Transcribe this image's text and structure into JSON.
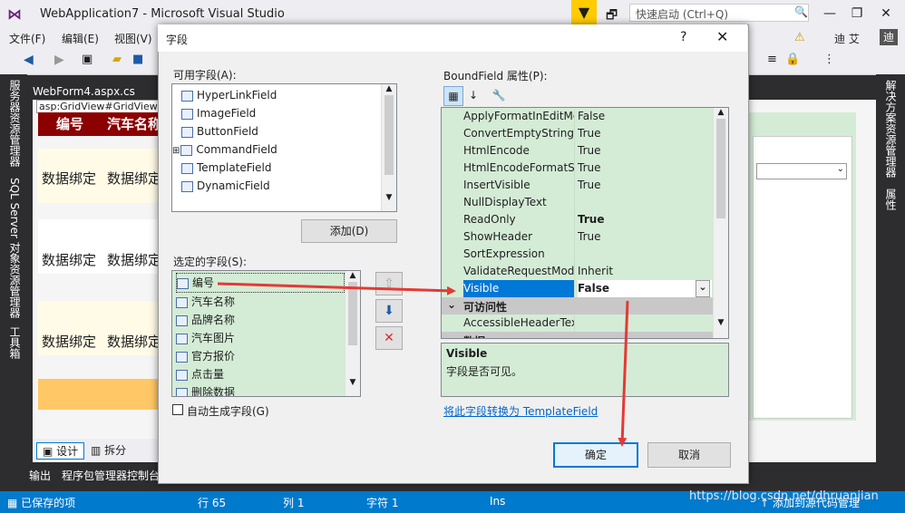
{
  "app": {
    "title": "WebApplication7 - Microsoft Visual Studio",
    "quick_launch_placeholder": "快速启动 (Ctrl+Q)",
    "user": "迪 艾",
    "user_badge": "迪"
  },
  "menu": [
    "文件(F)",
    "编辑(E)",
    "视图(V)"
  ],
  "left_tabs": [
    "服务器资源管理器",
    "SQL Server 对象资源管理器",
    "工具箱"
  ],
  "right_tabs": [
    "解决方案资源管理器",
    "属性"
  ],
  "document": {
    "tab": "WebForm4.aspx.cs",
    "asp_path": "asp:GridView#GridView1",
    "grid_header": [
      "编号",
      "汽车名称"
    ],
    "grid_rows": [
      [
        "数据绑定",
        "数据绑定"
      ],
      [
        "数据绑定",
        "数据绑定"
      ],
      [
        "数据绑定",
        "数据绑定"
      ]
    ],
    "bottom_tabs": [
      "设计",
      "拆分"
    ],
    "output_tabs": [
      "输出",
      "程序包管理器控制台"
    ]
  },
  "dialog": {
    "title": "字段",
    "help": "?",
    "available_label": "可用字段(A):",
    "available_fields": [
      "HyperLinkField",
      "ImageField",
      "ButtonField",
      "CommandField",
      "TemplateField",
      "DynamicField"
    ],
    "add_button": "添加(D)",
    "selected_label": "选定的字段(S):",
    "selected_fields": [
      "编号",
      "汽车名称",
      "品牌名称",
      "汽车图片",
      "官方报价",
      "点击量",
      "删除数据"
    ],
    "autogen_label": "自动生成字段(G)",
    "properties_label": "BoundField 属性(P):",
    "properties": [
      {
        "name": "ApplyFormatInEditMode",
        "value": "False"
      },
      {
        "name": "ConvertEmptyStringToNull",
        "value": "True"
      },
      {
        "name": "HtmlEncode",
        "value": "True"
      },
      {
        "name": "HtmlEncodeFormatString",
        "value": "True"
      },
      {
        "name": "InsertVisible",
        "value": "True"
      },
      {
        "name": "NullDisplayText",
        "value": ""
      },
      {
        "name": "ReadOnly",
        "value": "True"
      },
      {
        "name": "ShowHeader",
        "value": "True"
      },
      {
        "name": "SortExpression",
        "value": ""
      },
      {
        "name": "ValidateRequestMode",
        "value": "Inherit"
      },
      {
        "name": "Visible",
        "value": "False"
      }
    ],
    "category_accessibility": "可访问性",
    "accessible_header": "AccessibleHeaderText",
    "category_data": "数据",
    "desc_title": "Visible",
    "desc_text": "字段是否可见。",
    "convert_link": "将此字段转换为 TemplateField",
    "ok_button": "确定",
    "cancel_button": "取消"
  },
  "status": {
    "saved": "已保存的项",
    "row": "行 65",
    "col": "列 1",
    "char": "字符 1",
    "ins": "Ins",
    "publish": "添加到源代码管理"
  },
  "watermark": "https://blog.csdn.net/dhruanjian",
  "colors": {
    "accent": "#007acc",
    "arrow": "#e53935",
    "grid_header": "#8b0000",
    "highlight": "#0078d7"
  }
}
